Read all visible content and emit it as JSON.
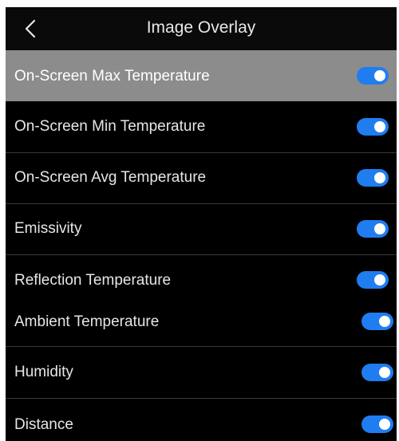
{
  "header": {
    "title": "Image Overlay"
  },
  "items": [
    {
      "label": "On-Screen Max Temperature",
      "enabled": true
    },
    {
      "label": "On-Screen Min Temperature",
      "enabled": true
    },
    {
      "label": "On-Screen Avg Temperature",
      "enabled": true
    },
    {
      "label": "Emissivity",
      "enabled": true
    },
    {
      "label": "Reflection Temperature",
      "enabled": true
    },
    {
      "label": "Ambient Temperature",
      "enabled": true
    },
    {
      "label": "Humidity",
      "enabled": true
    },
    {
      "label": "Distance",
      "enabled": true
    }
  ],
  "colors": {
    "accent": "#1f7df0",
    "background": "#000000",
    "selected_row": "#8c8c8c",
    "text": "#e6e6e6"
  }
}
